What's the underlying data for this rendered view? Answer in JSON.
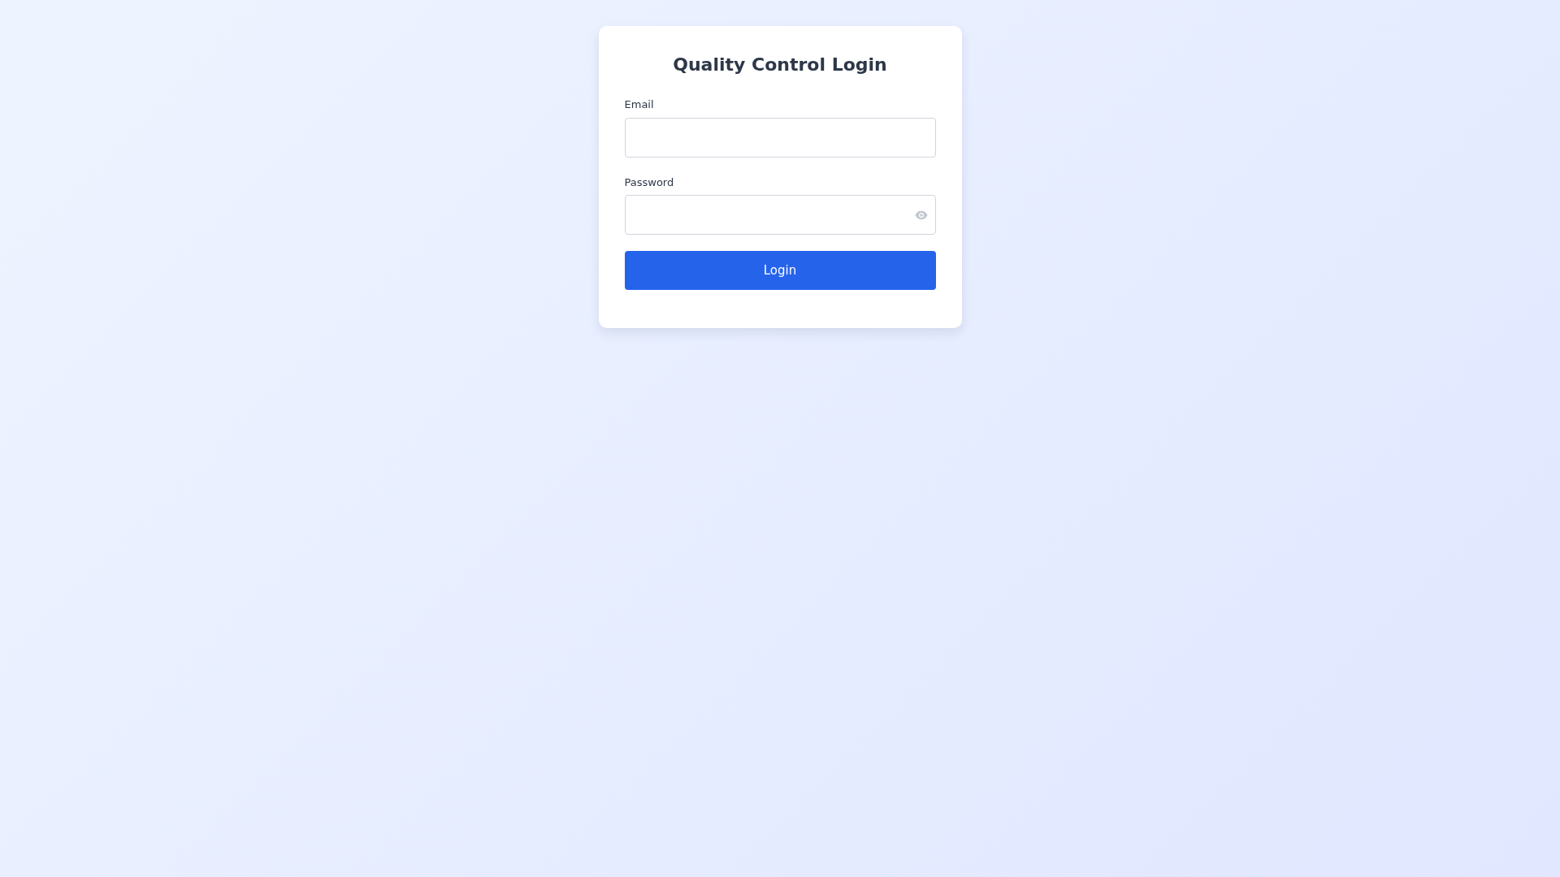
{
  "title": "Quality Control Login",
  "fields": [
    {
      "label": "Email",
      "kind": "email"
    },
    {
      "label": "Password",
      "kind": "password"
    }
  ],
  "button": "Login"
}
